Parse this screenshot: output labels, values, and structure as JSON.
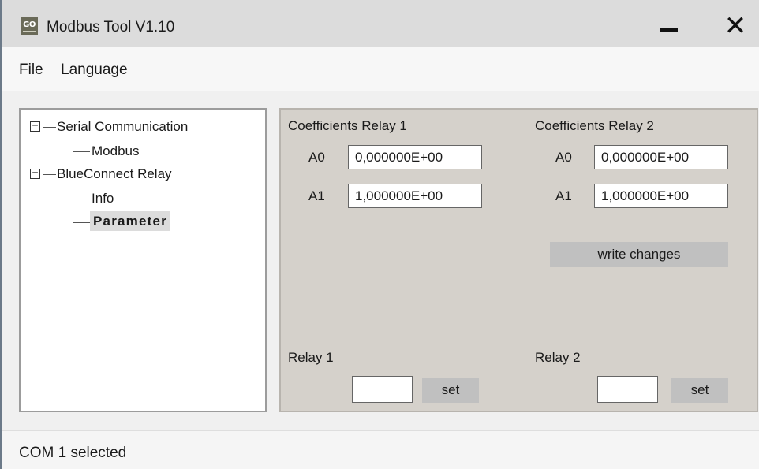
{
  "window": {
    "logo_text": "GO",
    "title": "Modbus Tool V1.10",
    "minimize_icon": "minimize-icon",
    "close_symbol": "✕"
  },
  "menu": {
    "items": [
      "File",
      "Language"
    ]
  },
  "tree": {
    "nodes": [
      {
        "label": "Serial Communication",
        "expanded": true,
        "children": [
          "Modbus"
        ]
      },
      {
        "label": "BlueConnect Relay",
        "expanded": true,
        "children": [
          "Info",
          "Parameter"
        ]
      }
    ],
    "expander_symbol": "−",
    "selected": "Parameter"
  },
  "parameters": {
    "relay1": {
      "heading": "Coefficients Relay 1",
      "a0_label": "A0",
      "a0_value": "0,000000E+00",
      "a1_label": "A1",
      "a1_value": "1,000000E+00",
      "relay_label": "Relay 1",
      "relay_value": "",
      "set_label": "set"
    },
    "relay2": {
      "heading": "Coefficients Relay 2",
      "a0_label": "A0",
      "a0_value": "0,000000E+00",
      "a1_label": "A1",
      "a1_value": "1,000000E+00",
      "relay_label": "Relay 2",
      "relay_value": "",
      "set_label": "set"
    },
    "write_label": "write changes"
  },
  "status": {
    "text": "COM 1 selected"
  },
  "colors": {
    "titlebar": "#dcdcdc",
    "panel_background": "#d5d1cb",
    "button": "#c0c0c0",
    "selected_item": "#dcdcdc"
  }
}
